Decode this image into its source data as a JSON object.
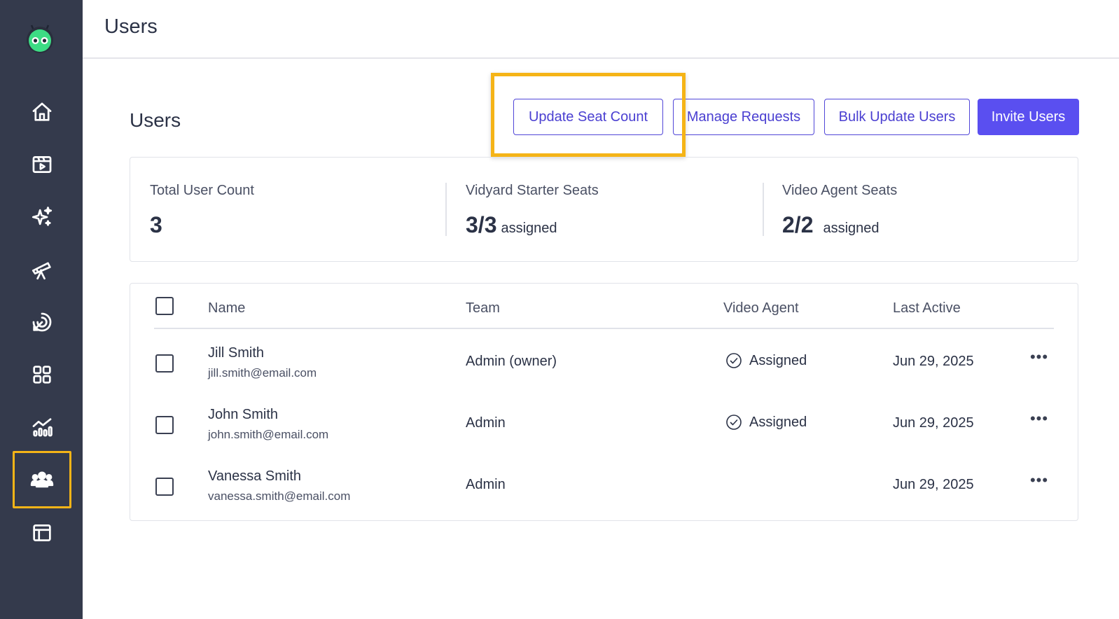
{
  "header": {
    "title": "Users"
  },
  "page": {
    "section_title": "Users"
  },
  "actions": {
    "update_seat_count": "Update Seat Count",
    "manage_requests": "Manage Requests",
    "bulk_update_users": "Bulk Update Users",
    "invite_users": "Invite Users"
  },
  "stats": [
    {
      "label": "Total User Count",
      "value": "3",
      "suffix": ""
    },
    {
      "label": "Vidyard Starter Seats",
      "value": "3/3",
      "suffix": "assigned"
    },
    {
      "label": "Video Agent Seats",
      "value": "2/2",
      "suffix": "assigned"
    }
  ],
  "table": {
    "columns": [
      "Name",
      "Team",
      "Video Agent",
      "Last Active"
    ],
    "rows": [
      {
        "name": "Jill Smith",
        "email": "jill.smith@email.com",
        "team": "Admin (owner)",
        "video_agent": "Assigned",
        "last_active": "Jun 29, 2025",
        "more": "•••"
      },
      {
        "name": "John Smith",
        "email": "john.smith@email.com",
        "team": "Admin",
        "video_agent": "Assigned",
        "last_active": "Jun 29, 2025",
        "more": "•••"
      },
      {
        "name": "Vanessa Smith",
        "email": "vanessa.smith@email.com",
        "team": "Admin",
        "video_agent": "",
        "last_active": "Jun 29, 2025",
        "more": "•••"
      }
    ]
  },
  "sidebar": {
    "items": [
      {
        "icon": "home-icon"
      },
      {
        "icon": "video-library-icon"
      },
      {
        "icon": "sparkles-icon"
      },
      {
        "icon": "telescope-icon"
      },
      {
        "icon": "target-icon"
      },
      {
        "icon": "apps-grid-icon"
      },
      {
        "icon": "analytics-icon"
      },
      {
        "icon": "users-icon",
        "active": true
      },
      {
        "icon": "layout-icon"
      }
    ]
  },
  "colors": {
    "sidebar_bg": "#343a4c",
    "accent": "#5a4ff0",
    "highlight": "#f5b417",
    "logo_green": "#3ddc84"
  }
}
